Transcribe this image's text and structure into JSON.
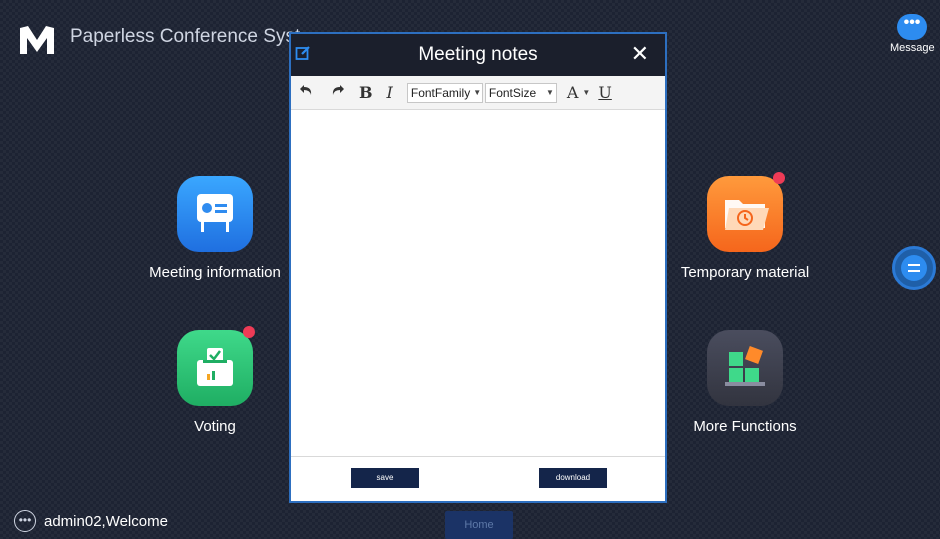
{
  "header": {
    "app_title": "Paperless Conference Syst",
    "message_label": "Message",
    "message_icon_glyph": "•••"
  },
  "tiles": {
    "meeting_info": "Meeting information",
    "voting": "Voting",
    "temporary_material": "Temporary material",
    "more_functions": "More Functions"
  },
  "colors": {
    "accent": "#2d8cf0",
    "badge": "#ee3b56",
    "modal_header": "#1b1f2c",
    "footer_button": "#14254a"
  },
  "modal": {
    "title": "Meeting notes",
    "close_glyph": "✕",
    "toolbar": {
      "undo_icon": "undo-icon",
      "redo_icon": "redo-icon",
      "bold": "B",
      "italic": "I",
      "font_family": "FontFamily",
      "font_size": "FontSize",
      "font_color": "A",
      "underline": "U"
    },
    "editor_content": "",
    "save_label": "save",
    "download_label": "download"
  },
  "footer": {
    "user_icon_glyph": "•••",
    "welcome": "admin02,Welcome",
    "home_label": "Home"
  }
}
